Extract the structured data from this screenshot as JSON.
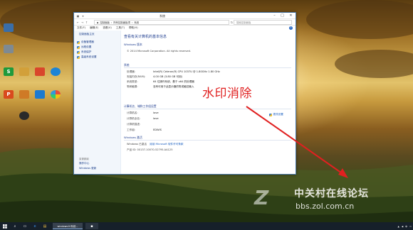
{
  "desktop": {
    "icons": [
      {
        "label": "This PC",
        "glyph": "computer-icon",
        "color": "#3a6ea8"
      },
      {
        "label": "Recycle Bin",
        "glyph": "recycle-bin-icon",
        "color": "#7f8a92"
      },
      {
        "label": "S",
        "glyph": "wps-sheet-icon",
        "color": "#1f9a3c"
      },
      {
        "label": "",
        "glyph": "document-icon",
        "color": "#d2a03a"
      },
      {
        "label": "",
        "glyph": "software-store-icon",
        "color": "#d9462b"
      },
      {
        "label": "",
        "glyph": "qq-icon",
        "color": "#1d84d6"
      },
      {
        "label": "",
        "glyph": "media-icon",
        "color": "#cf7a26"
      },
      {
        "label": "P",
        "glyph": "wps-presentation-icon",
        "color": "#d94a1e"
      },
      {
        "label": "",
        "glyph": "security-icon",
        "color": "#1c7ad0"
      },
      {
        "label": "",
        "glyph": "pinwheel-icon",
        "color": "#7dbb3b"
      },
      {
        "label": "",
        "glyph": "media-player-icon",
        "color": "#2a2a2a"
      }
    ]
  },
  "window": {
    "title": "系统",
    "address": [
      "控制面板",
      "所有控制面板项",
      "系统"
    ],
    "search_placeholder": "搜索控制面板",
    "menu": [
      "文件(F)",
      "编辑(E)",
      "查看(V)",
      "工具(T)",
      "帮助(H)"
    ],
    "left_pane": {
      "home": "控制面板主页",
      "items": [
        "设备管理器",
        "远程设置",
        "系统保护",
        "高级系统设置"
      ],
      "see_also_title": "另请参阅",
      "see_also": [
        "操作中心",
        "Windows 更新"
      ]
    },
    "main": {
      "heading": "查看有关计算机的基本信息",
      "edition_section": "Windows 版本",
      "copyright": "© 2014 Microsoft Corporation. All rights reserved.",
      "system_section": "系统",
      "system_rows": [
        {
          "key": "处理器:",
          "value": "Intel(R) Celeron(R) CPU 1037U @ 1.80GHz   1.80 GHz"
        },
        {
          "key": "安装内存(RAM):",
          "value": "4.00 GB (3.80 GB 可用)"
        },
        {
          "key": "系统类型:",
          "value": "64 位操作系统，基于 x64 的处理器"
        },
        {
          "key": "笔和触摸:",
          "value": "没有可用于此显示器的笔或触控输入"
        }
      ],
      "computer_section": "计算机名、域和工作组设置",
      "computer_rows": [
        {
          "key": "计算机名:",
          "value": "love"
        },
        {
          "key": "计算机全名:",
          "value": "love"
        },
        {
          "key": "计算机描述:",
          "value": ""
        },
        {
          "key": "工作组:",
          "value": "EDWIS"
        }
      ],
      "change_settings": "更改设置",
      "activation_section": "Windows 激活",
      "activation_status": "Windows 已激活",
      "license_link": "阅读 Microsoft 软件许可条款",
      "product_id": "产品 ID: 00137-10070-52795-AA125"
    }
  },
  "overlay": {
    "annotation": "水印消除",
    "annotation_color": "#e02020",
    "logo_mark": "Z",
    "logo_cn": "中关村在线论坛",
    "logo_url": "bbs.zol.com.cn"
  },
  "taskbar": {
    "items": [
      "start-icon",
      "search-icon",
      "task-view-icon",
      "edge-icon",
      "file-explorer-icon"
    ],
    "active_label": "windows10系统..."
  }
}
